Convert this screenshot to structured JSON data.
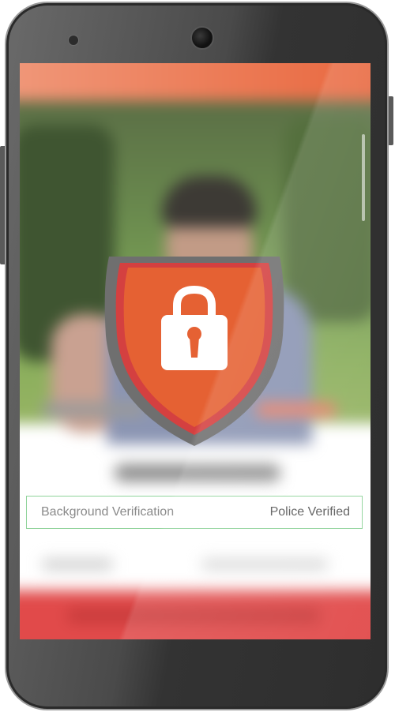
{
  "verification": {
    "label": "Background Verification",
    "value": "Police Verified"
  },
  "icons": {
    "shield": "shield-lock-icon",
    "lock": "padlock-icon"
  },
  "colors": {
    "accent": "#e8633a",
    "shield_fill": "#e56133",
    "shield_inner_border": "#d44040",
    "shield_outer_border": "#6f6f6f",
    "verified_border": "#8fd39a",
    "bottom_bar": "#e14a4a",
    "app_bar": "#ec7a55"
  }
}
